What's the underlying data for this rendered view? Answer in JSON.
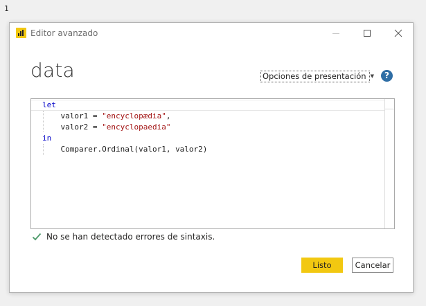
{
  "page": {
    "corner_label": "1"
  },
  "window": {
    "title": "Editor avanzado",
    "app_icon": "power-bi-icon",
    "controls": {
      "minimize_icon": "minimize-icon",
      "maximize_icon": "maximize-icon",
      "close_icon": "close-icon"
    }
  },
  "query": {
    "name": "data"
  },
  "toolbar": {
    "display_options_label": "Opciones de presentación",
    "display_options_icon": "chevron-down-icon",
    "help_label": "?",
    "help_icon": "help-icon"
  },
  "editor": {
    "lines": [
      {
        "indent": "",
        "kw": "let",
        "pre": "",
        "str": "",
        "post": ""
      },
      {
        "indent": "    ",
        "kw": "",
        "pre": "valor1 = ",
        "str": "\"encyclopædia\"",
        "post": ","
      },
      {
        "indent": "    ",
        "kw": "",
        "pre": "valor2 = ",
        "str": "\"encyclopaedia\"",
        "post": ""
      },
      {
        "indent": "",
        "kw": "in",
        "pre": "",
        "str": "",
        "post": ""
      },
      {
        "indent": "    ",
        "kw": "",
        "pre": "Comparer.Ordinal(valor1, valor2)",
        "str": "",
        "post": ""
      }
    ]
  },
  "status": {
    "icon": "checkmark-icon",
    "text": "No se han detectado errores de sintaxis.",
    "color": "#4c9a6a"
  },
  "buttons": {
    "ok_label": "Listo",
    "cancel_label": "Cancelar"
  },
  "colors": {
    "accent": "#f2c811",
    "keyword": "#0000c8",
    "string": "#a31515",
    "help": "#2f6ea5"
  }
}
